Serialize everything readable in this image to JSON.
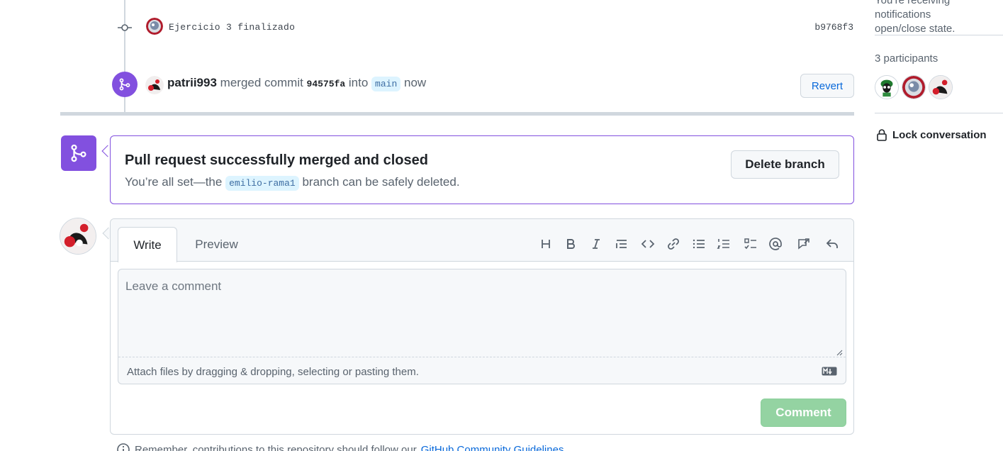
{
  "timeline": {
    "commit": {
      "message": "Ejercicio 3 finalizado",
      "sha": "b9768f3"
    },
    "merge_event": {
      "user": "patrii993",
      "action": "merged commit",
      "commit_sha": "94575fa",
      "into_word": "into",
      "branch": "main",
      "time": "now",
      "revert_label": "Revert"
    }
  },
  "merged_box": {
    "title": "Pull request successfully merged and closed",
    "sub_prefix": "You’re all set—the",
    "branch": "emilio-rama1",
    "sub_suffix": "branch can be safely deleted.",
    "delete_label": "Delete branch"
  },
  "composer": {
    "tabs": {
      "write": "Write",
      "preview": "Preview"
    },
    "toolbar_icons": [
      "heading-icon",
      "bold-icon",
      "italic-icon",
      "quote-icon",
      "code-icon",
      "link-icon",
      "unordered-list-icon",
      "ordered-list-icon",
      "task-list-icon",
      "mention-icon",
      "cross-reference-icon",
      "reply-icon"
    ],
    "placeholder": "Leave a comment",
    "attach_text": "Attach files by dragging & dropping, selecting or pasting them.",
    "comment_label": "Comment"
  },
  "footer": {
    "note_prefix": "Remember, contributions to this repository should follow our",
    "link_text": "GitHub Community Guidelines"
  },
  "sidebar": {
    "notification_line1": "You’re receiving notifications",
    "notification_line2": "open/close state.",
    "participants_label": "3 participants",
    "lock_label": "Lock conversation"
  },
  "colors": {
    "merged_purple": "#8250df",
    "link_blue": "#0969da",
    "comment_button_disabled": "#94d3a2",
    "border": "#d0d7de"
  }
}
